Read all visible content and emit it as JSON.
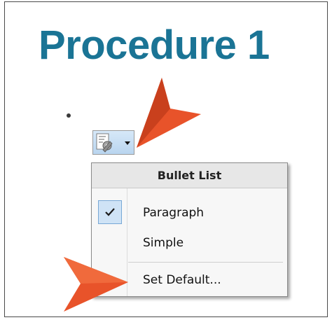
{
  "document": {
    "heading": "Procedure 1"
  },
  "toolbar": {
    "style_button_icon": "bullet-style-gear-icon"
  },
  "menu": {
    "title": "Bullet List",
    "items": [
      {
        "label": "Paragraph",
        "checked": true
      },
      {
        "label": "Simple",
        "checked": false
      },
      {
        "label": "Set Default...",
        "checked": false
      }
    ]
  },
  "colors": {
    "heading": "#1a7495",
    "callout_arrow": "#e8532a",
    "selected_check_bg": "#cfe3f6"
  }
}
